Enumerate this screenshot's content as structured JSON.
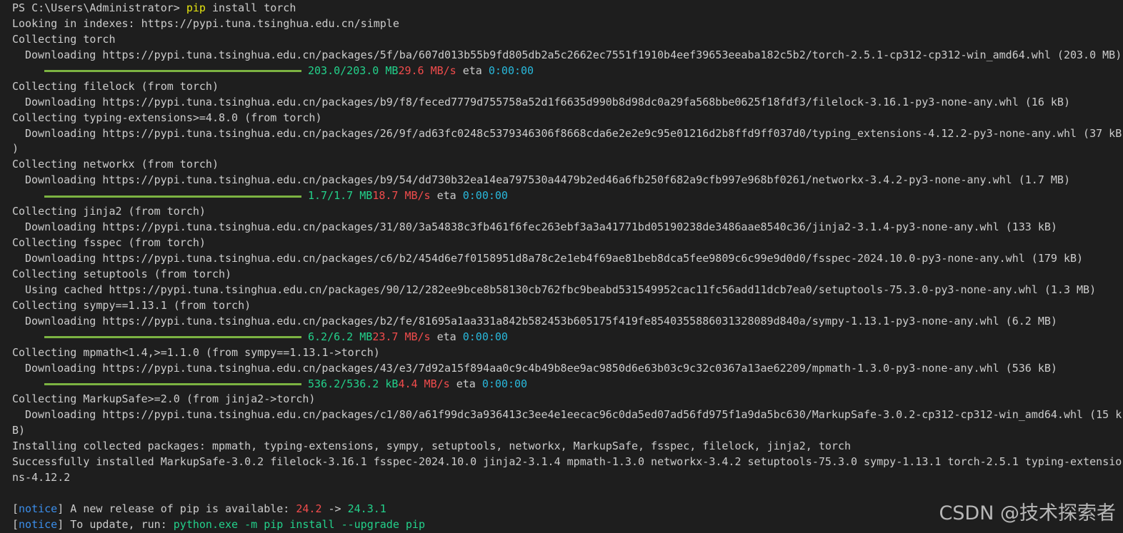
{
  "prompt": {
    "ps": "PS C:\\Users\\Administrator> ",
    "cmd_pip": "pip",
    "cmd_rest": " install torch"
  },
  "index_line": "Looking in indexes: https://pypi.tuna.tsinghua.edu.cn/simple",
  "torch": {
    "collect": "Collecting torch",
    "download": "Downloading https://pypi.tuna.tsinghua.edu.cn/packages/5f/ba/607d013b55b9fd805db2a5c2662ec7551f1910b4eef39653eeaba182c5b2/torch-2.5.1-cp312-cp312-win_amd64.whl (203.0 MB)",
    "size": "203.0/203.0 MB",
    "speed": "29.6 MB/s",
    "eta_label": " eta ",
    "eta": "0:00:00",
    "progress": 1.0
  },
  "filelock": {
    "collect": "Collecting filelock (from torch)",
    "download": "Downloading https://pypi.tuna.tsinghua.edu.cn/packages/b9/f8/feced7779d755758a52d1f6635d990b8d98dc0a29fa568bbe0625f18fdf3/filelock-3.16.1-py3-none-any.whl (16 kB)"
  },
  "typing": {
    "collect": "Collecting typing-extensions>=4.8.0 (from torch)",
    "download": "Downloading https://pypi.tuna.tsinghua.edu.cn/packages/26/9f/ad63fc0248c5379346306f8668cda6e2e2e9c95e01216d2b8ffd9ff037d0/typing_extensions-4.12.2-py3-none-any.whl (37 kB",
    "wrap": ")"
  },
  "networkx": {
    "collect": "Collecting networkx (from torch)",
    "download": "Downloading https://pypi.tuna.tsinghua.edu.cn/packages/b9/54/dd730b32ea14ea797530a4479b2ed46a6fb250f682a9cfb997e968bf0261/networkx-3.4.2-py3-none-any.whl (1.7 MB)",
    "size": "1.7/1.7 MB",
    "speed": "18.7 MB/s",
    "eta_label": " eta ",
    "eta": "0:00:00",
    "progress": 1.0
  },
  "jinja2": {
    "collect": "Collecting jinja2 (from torch)",
    "download": "Downloading https://pypi.tuna.tsinghua.edu.cn/packages/31/80/3a54838c3fb461f6fec263ebf3a3a41771bd05190238de3486aae8540c36/jinja2-3.1.4-py3-none-any.whl (133 kB)"
  },
  "fsspec": {
    "collect": "Collecting fsspec (from torch)",
    "download": "Downloading https://pypi.tuna.tsinghua.edu.cn/packages/c6/b2/454d6e7f0158951d8a78c2e1eb4f69ae81beb8dca5fee9809c6c99e9d0d0/fsspec-2024.10.0-py3-none-any.whl (179 kB)"
  },
  "setuptools": {
    "collect": "Collecting setuptools (from torch)",
    "download": "Using cached https://pypi.tuna.tsinghua.edu.cn/packages/90/12/282ee9bce8b58130cb762fbc9beabd531549952cac11fc56add11dcb7ea0/setuptools-75.3.0-py3-none-any.whl (1.3 MB)"
  },
  "sympy": {
    "collect": "Collecting sympy==1.13.1 (from torch)",
    "download": "Downloading https://pypi.tuna.tsinghua.edu.cn/packages/b2/fe/81695a1aa331a842b582453b605175f419fe8540355886031328089d840a/sympy-1.13.1-py3-none-any.whl (6.2 MB)",
    "size": "6.2/6.2 MB",
    "speed": "23.7 MB/s",
    "eta_label": " eta ",
    "eta": "0:00:00",
    "progress": 1.0
  },
  "mpmath": {
    "collect": "Collecting mpmath<1.4,>=1.1.0 (from sympy==1.13.1->torch)",
    "download": "Downloading https://pypi.tuna.tsinghua.edu.cn/packages/43/e3/7d92a15f894aa0c9c4b49b8ee9ac9850d6e63b03c9c32c0367a13ae62209/mpmath-1.3.0-py3-none-any.whl (536 kB)",
    "size": "536.2/536.2 kB",
    "speed": "4.4 MB/s",
    "eta_label": " eta ",
    "eta": "0:00:00",
    "progress": 1.0
  },
  "markupsafe": {
    "collect": "Collecting MarkupSafe>=2.0 (from jinja2->torch)",
    "download": "Downloading https://pypi.tuna.tsinghua.edu.cn/packages/c1/80/a61f99dc3a936413c3ee4e1eecac96c0da5ed07ad56fd975f1a9da5bc630/MarkupSafe-3.0.2-cp312-cp312-win_amd64.whl (15 k",
    "wrap": "B)"
  },
  "installing": "Installing collected packages: mpmath, typing-extensions, sympy, setuptools, networkx, MarkupSafe, fsspec, filelock, jinja2, torch",
  "success": {
    "line1": "Successfully installed MarkupSafe-3.0.2 filelock-3.16.1 fsspec-2024.10.0 jinja2-3.1.4 mpmath-1.3.0 networkx-3.4.2 setuptools-75.3.0 sympy-1.13.1 torch-2.5.1 typing-extensio",
    "line2": "ns-4.12.2"
  },
  "notice1": {
    "open": "[",
    "tag": "notice",
    "close": "]",
    "text": " A new release of pip is available: ",
    "old_version": "24.2",
    "arrow": " -> ",
    "new_version": "24.3.1"
  },
  "notice2": {
    "open": "[",
    "tag": "notice",
    "close": "]",
    "text": " To update, run: ",
    "command": "python.exe -m pip install --upgrade pip"
  },
  "watermark": "CSDN @技术探索者",
  "colors": {
    "background": "#1e1e1e",
    "text": "#cccccc",
    "success_green": "#23d18b",
    "speed_red": "#f14c4c",
    "eta_cyan": "#29b8db",
    "command_yellow": "#e5e510",
    "notice_blue": "#3b8eea",
    "progress_bar": "#7cb342"
  }
}
